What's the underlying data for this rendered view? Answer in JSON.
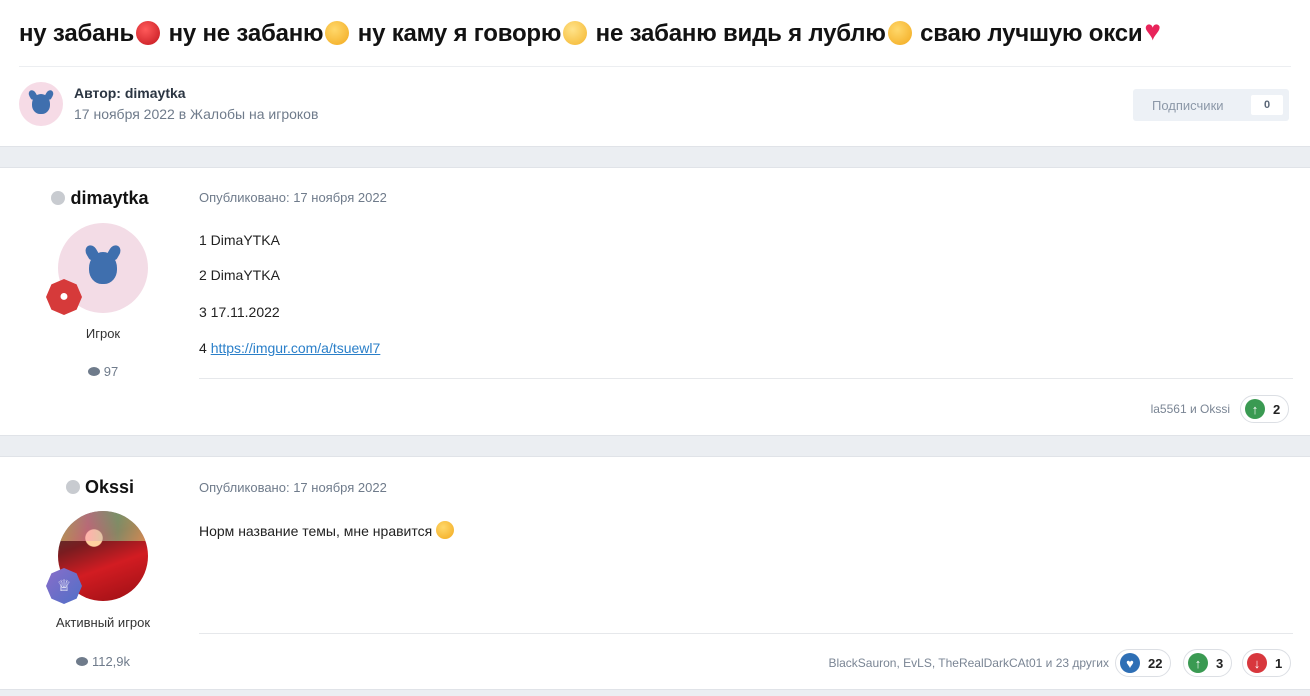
{
  "topic": {
    "title_parts": [
      "ну забань",
      "ну не забаню",
      "ну каму я говорю",
      "не забаню видь я лублю",
      "сваю лучшую окси"
    ],
    "emoji_icons": [
      "angry-face-icon",
      "smiling-hearts-face-icon",
      "eye-roll-face-icon",
      "kiss-face-icon",
      "sparkling-heart-icon"
    ]
  },
  "author": {
    "label": "Автор: dimaytka",
    "meta": "17 ноября 2022 в Жалобы на игроков"
  },
  "follow": {
    "label": "Подписчики",
    "count": "0"
  },
  "posts": [
    {
      "username": "dimaytka",
      "rank": "Игрок",
      "post_count": "97",
      "published": "Опубликовано: 17 ноября 2022",
      "lines": [
        "1 DimaYTKA",
        "2 DimaYTKA",
        "3 17.11.2022"
      ],
      "line4_prefix": "4 ",
      "link": "https://imgur.com/a/tsuewl7",
      "likers": "la5561 и Okssi",
      "reactions": [
        {
          "icon": "upvote-icon",
          "count": "2"
        }
      ]
    },
    {
      "username": "Okssi",
      "rank": "Активный игрок",
      "post_count": "112,9k",
      "published": "Опубликовано: 17 ноября 2022",
      "text": "Норм название темы, мне нравится",
      "likers": "BlackSauron, EvLS, TheRealDarkCAt01 и 23 других",
      "reactions": [
        {
          "icon": "heart-icon",
          "count": "22"
        },
        {
          "icon": "upvote-icon",
          "count": "3"
        },
        {
          "icon": "downvote-icon",
          "count": "1"
        }
      ]
    }
  ]
}
